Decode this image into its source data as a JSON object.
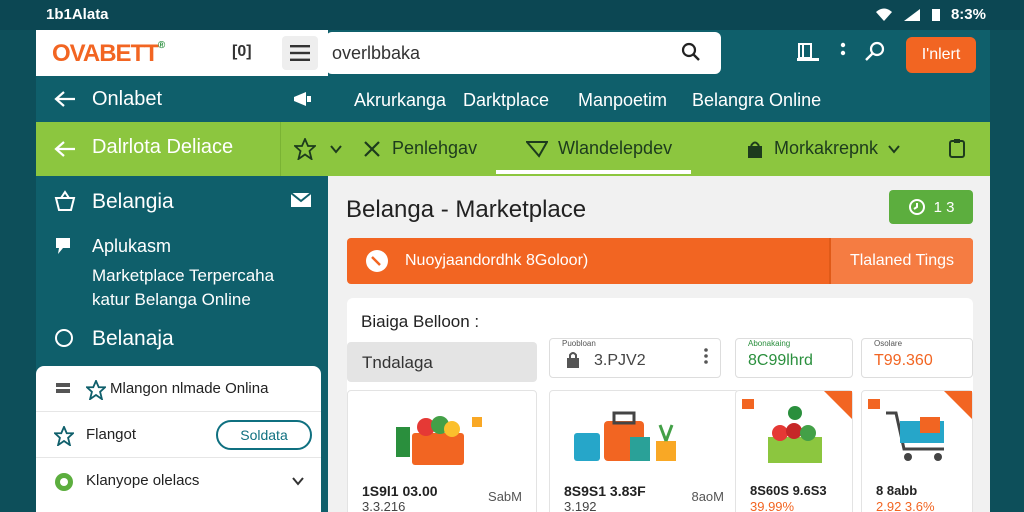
{
  "status": {
    "time": "1b1Alata",
    "battery": "8:3%"
  },
  "logo": {
    "text": "OVABETT",
    "mark": "®",
    "mid": "[0]"
  },
  "search": {
    "value": "overlbbaka"
  },
  "header": {
    "button": "I'nlert"
  },
  "nav1": {
    "back_label": "Onlabet",
    "items": [
      "Akrurkanga",
      "Darktplace",
      "Manpoetim",
      "Belangra Online"
    ]
  },
  "nav2": {
    "back_label": "Dalrlota Deliace",
    "items": [
      "Penlehgav",
      "Wlandelepdev",
      "Morkakrepnk"
    ]
  },
  "drawer": {
    "sections": [
      {
        "title": "Belangia"
      },
      {
        "title": "Aplukasm",
        "lines": [
          "Marketplace Terpercaha",
          "katur Belanga Online"
        ]
      },
      {
        "title": "Belanaja"
      }
    ],
    "bottom": [
      {
        "label": "Mlangon nlmade Onlina"
      },
      {
        "label": "Flangot",
        "pill": "Soldata"
      },
      {
        "label": "Klanyope olelacs"
      }
    ]
  },
  "main": {
    "title": "Belanga - Marketplace",
    "badge": "1 3",
    "banner": {
      "text": "Nuoyjaandordhk 8Goloor)",
      "button": "Tlalaned Tings"
    },
    "panel": {
      "title": "Biaiga Belloon :",
      "chip": "Tndalaga",
      "minis": [
        {
          "label": "Puobloan",
          "value": "3.PJV2"
        },
        {
          "label": "Abonakaing",
          "value": "8C99lhrd"
        },
        {
          "label": "Osolare",
          "value": "T99.360"
        }
      ],
      "cards": [
        {
          "price": "1S9l1 03.00",
          "sub": "3.3.216",
          "extra": "SabM"
        },
        {
          "price": "8S9S1 3.83F",
          "sub": "3.192",
          "extra": "8aoM"
        },
        {
          "price": "8S60S 9.6S3",
          "sub": "39.99%",
          "extra": ""
        },
        {
          "price": "8 8abb",
          "sub": "2.92 3.6%",
          "extra": ""
        }
      ]
    }
  },
  "colors": {
    "teal": "#0f5f6b",
    "green": "#8cc63f",
    "orange": "#f26522"
  }
}
